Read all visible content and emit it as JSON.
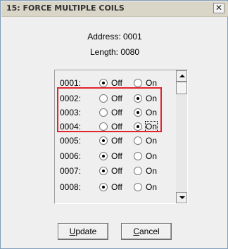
{
  "window": {
    "title": "15: FORCE MULTIPLE COILS",
    "close_glyph": "✕"
  },
  "info": {
    "address": "Address: 0001",
    "length": "Length: 0080"
  },
  "coils": [
    {
      "address": "0001:",
      "off_label": "Off",
      "on_label": "On",
      "value": "Off"
    },
    {
      "address": "0002:",
      "off_label": "Off",
      "on_label": "On",
      "value": "On"
    },
    {
      "address": "0003:",
      "off_label": "Off",
      "on_label": "On",
      "value": "On"
    },
    {
      "address": "0004:",
      "off_label": "Off",
      "on_label": "On",
      "value": "On"
    },
    {
      "address": "0005:",
      "off_label": "Off",
      "on_label": "On",
      "value": "Off"
    },
    {
      "address": "0006:",
      "off_label": "Off",
      "on_label": "On",
      "value": "Off"
    },
    {
      "address": "0007:",
      "off_label": "Off",
      "on_label": "On",
      "value": "Off"
    },
    {
      "address": "0008:",
      "off_label": "Off",
      "on_label": "On",
      "value": "Off"
    }
  ],
  "buttons": {
    "update_first": "U",
    "update_rest": "pdate",
    "cancel_first": "C",
    "cancel_rest": "ancel"
  },
  "colors": {
    "highlight": "#e0252b",
    "titlebar": "#d9d6c8"
  }
}
